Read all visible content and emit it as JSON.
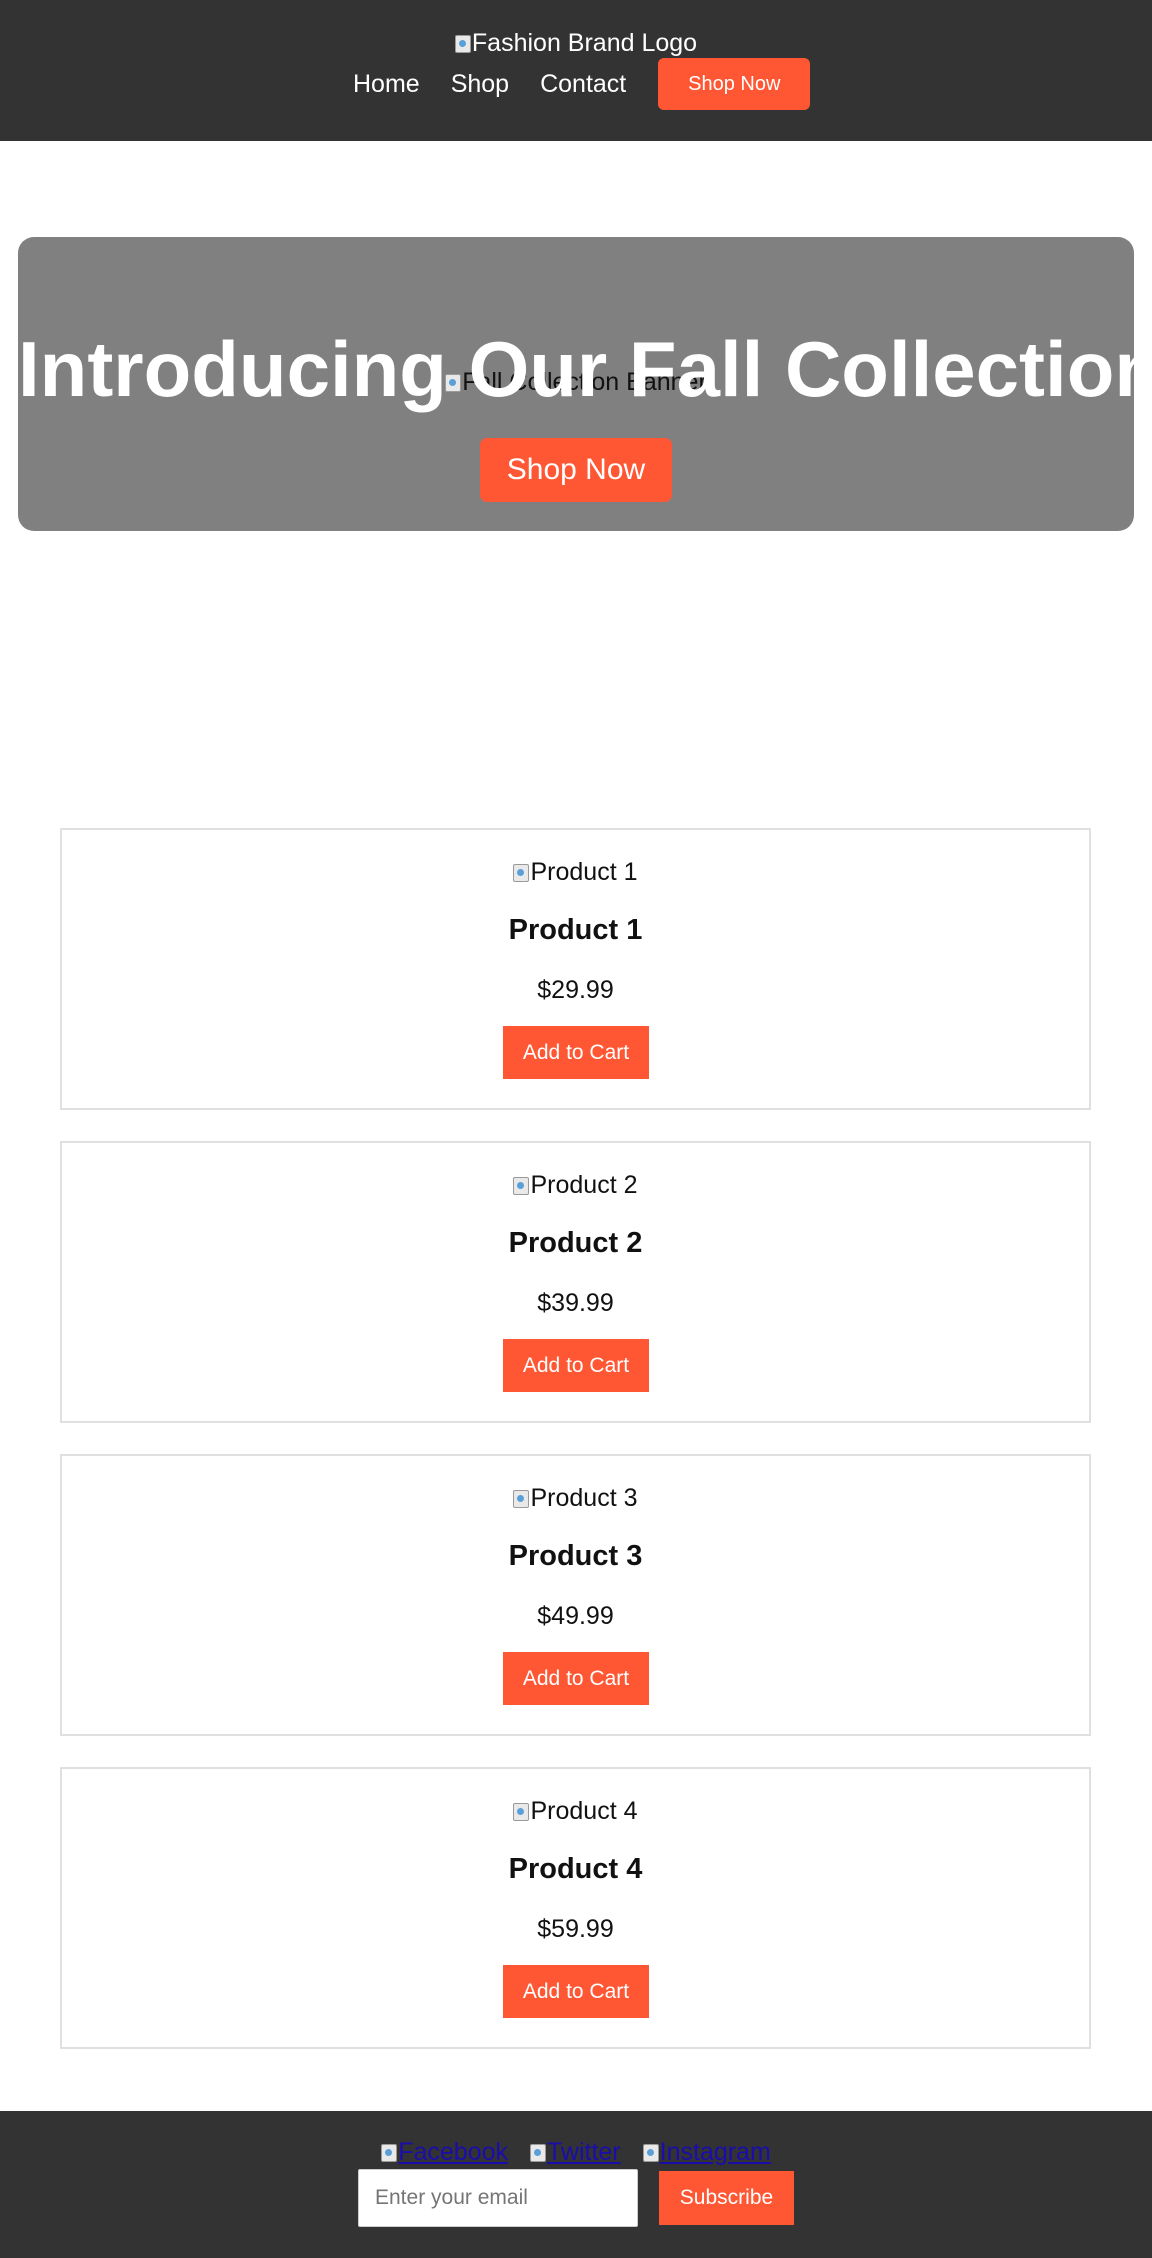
{
  "header": {
    "logo_alt": "Fashion Brand Logo",
    "nav": [
      {
        "label": "Home"
      },
      {
        "label": "Shop"
      },
      {
        "label": "Contact"
      }
    ],
    "cta_label": "Shop Now"
  },
  "hero": {
    "banner_alt": "Fall Collection Banner",
    "title": "Introducing Our Fall Collection",
    "cta_label": "Shop Now"
  },
  "products": [
    {
      "image_alt": "Product 1",
      "name": "Product 1",
      "price": "$29.99",
      "button_label": "Add to Cart"
    },
    {
      "image_alt": "Product 2",
      "name": "Product 2",
      "price": "$39.99",
      "button_label": "Add to Cart"
    },
    {
      "image_alt": "Product 3",
      "name": "Product 3",
      "price": "$49.99",
      "button_label": "Add to Cart"
    },
    {
      "image_alt": "Product 4",
      "name": "Product 4",
      "price": "$59.99",
      "button_label": "Add to Cart"
    }
  ],
  "footer": {
    "social": [
      {
        "label": "Facebook",
        "icon": "facebook-icon"
      },
      {
        "label": "Twitter",
        "icon": "twitter-icon"
      },
      {
        "label": "Instagram",
        "icon": "instagram-icon"
      }
    ],
    "email_placeholder": "Enter your email",
    "subscribe_label": "Subscribe"
  },
  "colors": {
    "header_bg": "#333333",
    "accent": "#ff5733",
    "hero_bg": "#808080",
    "link": "#1a0dab"
  }
}
